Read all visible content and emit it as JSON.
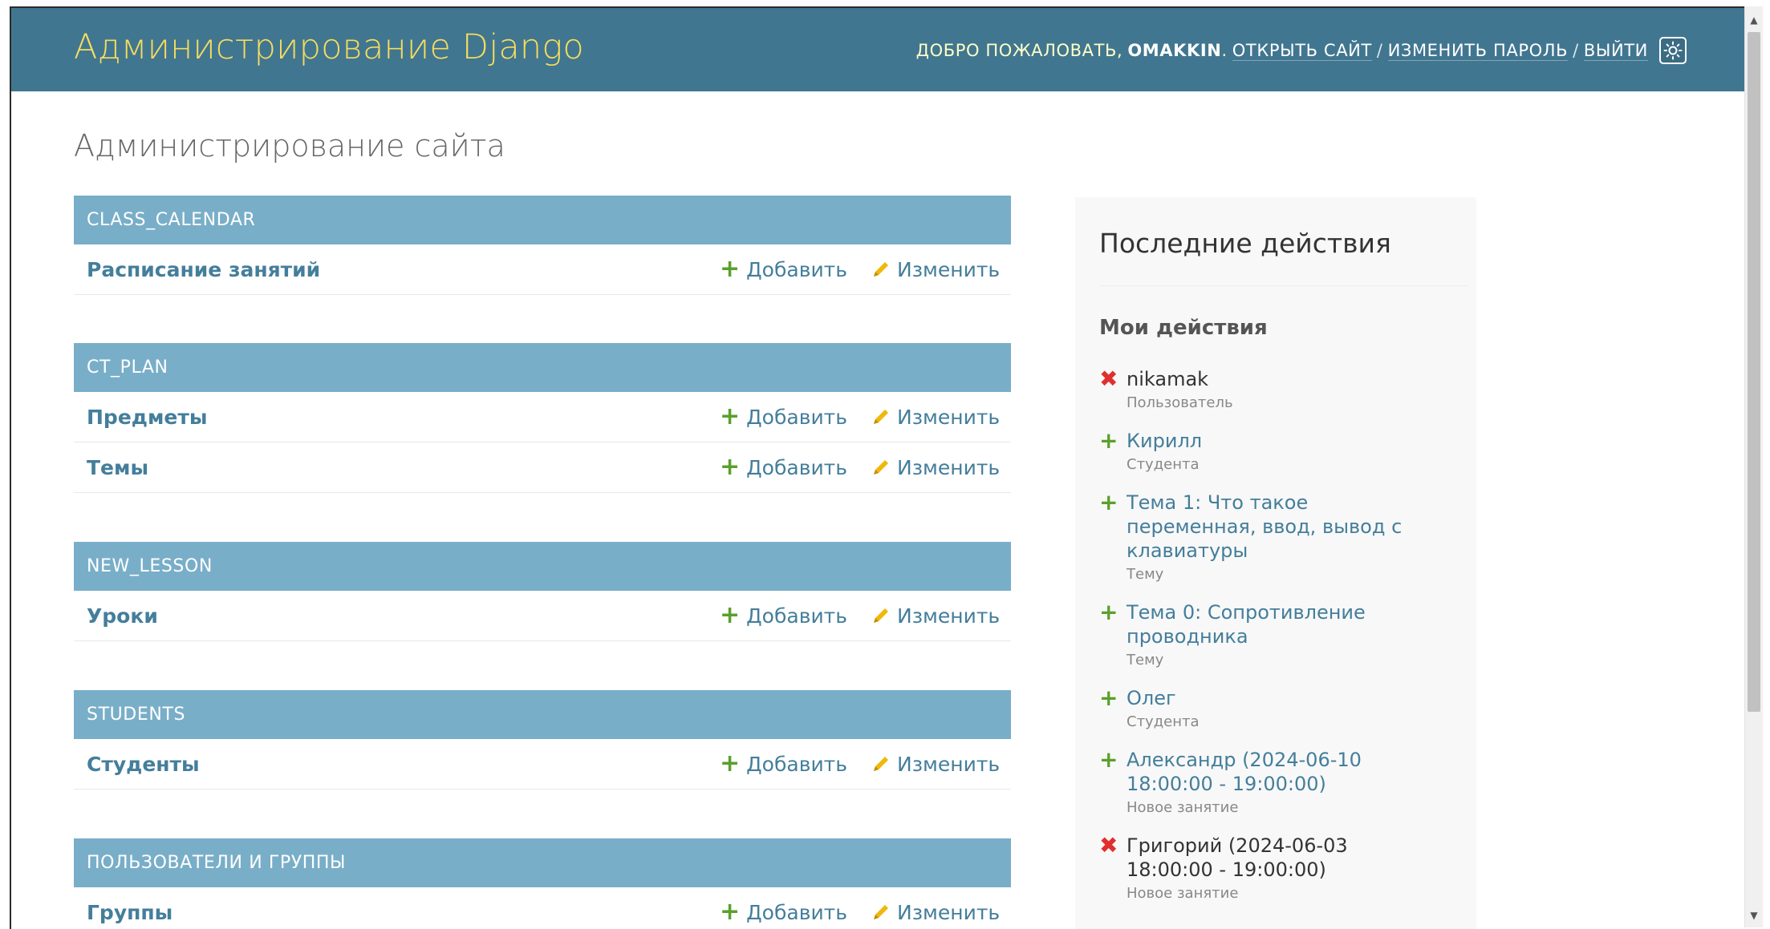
{
  "header": {
    "branding": "Администрирование Django",
    "welcome": "ДОБРО ПОЖАЛОВАТЬ,",
    "username": "OMAKKIN",
    "after_username": ".",
    "view_site": "ОТКРЫТЬ САЙТ",
    "change_password": "ИЗМЕНИТЬ ПАРОЛЬ",
    "logout": "ВЫЙТИ",
    "separator": "/",
    "theme_toggle_icon": "sun-icon"
  },
  "page_title": "Администрирование сайта",
  "labels": {
    "add": "Добавить",
    "change": "Изменить"
  },
  "colors": {
    "header_bg": "#417690",
    "branding": "#f5dd5d",
    "module_caption": "#79aec8",
    "link": "#447e9b",
    "add_icon": "#5aa02c",
    "delete_icon": "#e0302d"
  },
  "apps": [
    {
      "name": "CLASS_CALENDAR",
      "models": [
        {
          "name": "Расписание занятий"
        }
      ]
    },
    {
      "name": "CT_PLAN",
      "models": [
        {
          "name": "Предметы"
        },
        {
          "name": "Темы"
        }
      ]
    },
    {
      "name": "NEW_LESSON",
      "models": [
        {
          "name": "Уроки"
        }
      ]
    },
    {
      "name": "STUDENTS",
      "models": [
        {
          "name": "Студенты"
        }
      ]
    },
    {
      "name": "ПОЛЬЗОВАТЕЛИ И ГРУППЫ",
      "models": [
        {
          "name": "Группы"
        }
      ]
    }
  ],
  "recent_actions": {
    "title": "Последние действия",
    "subtitle": "Мои действия",
    "items": [
      {
        "kind": "delete",
        "title": "nikamak",
        "type": "Пользователь"
      },
      {
        "kind": "add",
        "title": "Кирилл",
        "type": "Студента"
      },
      {
        "kind": "add",
        "title": "Тема 1: Что такое переменная, ввод, вывод с клавиатуры",
        "type": "Тему"
      },
      {
        "kind": "add",
        "title": "Тема 0: Сопротивление проводника",
        "type": "Тему"
      },
      {
        "kind": "add",
        "title": "Олег",
        "type": "Студента"
      },
      {
        "kind": "add",
        "title": "Александр (2024-06-10 18:00:00 - 19:00:00)",
        "type": "Новое занятие"
      },
      {
        "kind": "delete",
        "title": "Григорий (2024-06-03 18:00:00 - 19:00:00)",
        "type": "Новое занятие"
      }
    ]
  }
}
